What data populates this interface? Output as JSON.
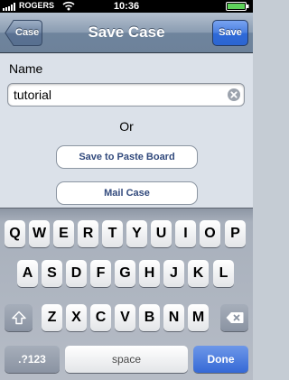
{
  "status_bar": {
    "carrier": "ROGERS",
    "time": "10:36"
  },
  "nav": {
    "title": "Save Case",
    "back_label": "Case",
    "save_label": "Save"
  },
  "form": {
    "name_label": "Name",
    "name_value": "tutorial",
    "or_label": "Or",
    "paste_button": "Save to Paste Board",
    "mail_button": "Mail Case"
  },
  "keyboard": {
    "row1": [
      "Q",
      "W",
      "E",
      "R",
      "T",
      "Y",
      "U",
      "I",
      "O",
      "P"
    ],
    "row2": [
      "A",
      "S",
      "D",
      "F",
      "G",
      "H",
      "J",
      "K",
      "L"
    ],
    "row3": [
      "Z",
      "X",
      "C",
      "V",
      "B",
      "N",
      "M"
    ],
    "numbers_label": ".?123",
    "space_label": "space",
    "done_label": "Done"
  },
  "colors": {
    "nav_bar": "#7f91a8",
    "save_button": "#3a72dd",
    "content_background": "#dbe1e9",
    "keyboard_background": "#b0b7c2",
    "button_text": "#324a7d"
  },
  "icons": [
    "signal-icon",
    "wifi-icon",
    "battery-icon",
    "clear-icon",
    "shift-icon",
    "backspace-icon"
  ]
}
